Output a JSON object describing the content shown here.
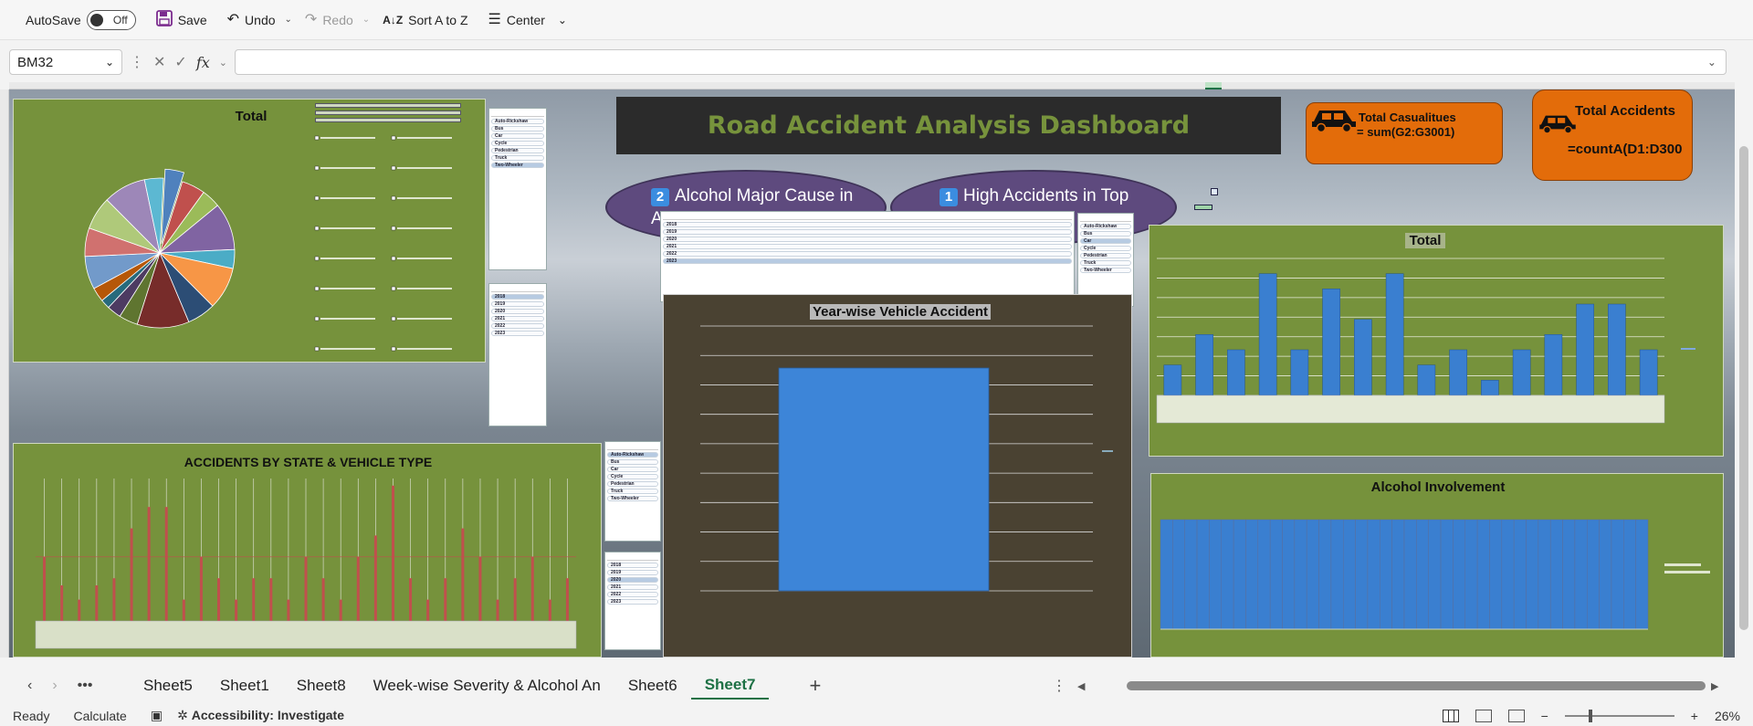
{
  "toolbar": {
    "autosave_label": "AutoSave",
    "autosave_state": "Off",
    "save_label": "Save",
    "undo_label": "Undo",
    "redo_label": "Redo",
    "sort_label": "Sort A to Z",
    "center_label": "Center"
  },
  "formula_bar": {
    "name_box": "BM32",
    "formula": ""
  },
  "dashboard": {
    "title": "Road Accident Analysis Dashboard",
    "insight1_num": "2",
    "insight1_text": "Alcohol Major Cause in Accidents",
    "insight2_num": "1",
    "insight2_text": "High Accidents in Top States",
    "kpi1_title": "Total Casualitues",
    "kpi1_formula": "= sum(G2:G3001)",
    "kpi2_title": "Total Accidents",
    "kpi2_formula": "=countA(D1:D300",
    "chart_pie_title": "Total",
    "chart_state_title": "ACCIDENTS BY STATE & VEHICLE TYPE",
    "chart_year_title": "Year-wise Vehicle Accident",
    "chart_total_title": "Total",
    "chart_alcohol_title": "Alcohol Involvement"
  },
  "chart_data": [
    {
      "type": "pie",
      "title": "Total",
      "values": [
        4,
        5,
        4,
        10,
        4,
        9,
        6,
        11,
        4,
        3,
        2,
        3,
        7,
        6,
        7,
        9,
        4
      ]
    },
    {
      "type": "bar",
      "title": "ACCIDENTS BY STATE & VEHICLE TYPE",
      "values": [
        9,
        5,
        3,
        5,
        6,
        13,
        16,
        16,
        3,
        9,
        6,
        3,
        6,
        6,
        3,
        9,
        6,
        3,
        9,
        12,
        19,
        6,
        3,
        6,
        13,
        9,
        3,
        6,
        9,
        3,
        6
      ]
    },
    {
      "type": "bar",
      "title": "Year-wise Vehicle Accident",
      "values": [
        1
      ]
    },
    {
      "type": "bar",
      "title": "Total",
      "values": [
        2,
        4,
        3,
        8,
        3,
        7,
        5,
        8,
        2,
        3,
        1,
        3,
        4,
        6,
        6,
        3
      ]
    },
    {
      "type": "bar",
      "title": "Alcohol Involvement",
      "values": [
        1,
        1,
        1,
        1,
        1,
        1,
        1,
        1,
        1,
        1,
        1,
        1,
        1,
        1,
        1,
        1,
        1,
        1,
        1,
        1,
        1,
        1,
        1,
        1,
        1,
        1,
        1,
        1,
        1,
        1,
        1,
        1,
        1,
        1,
        1,
        1,
        1,
        1,
        1,
        1
      ]
    }
  ],
  "slicers": {
    "vehicle_items": [
      "Auto-Rickshaw",
      "Bus",
      "Car",
      "Cycle",
      "Pedestrian",
      "Truck",
      "Two-Wheeler"
    ],
    "year_items": [
      "2018",
      "2019",
      "2020",
      "2021",
      "2022",
      "2023"
    ]
  },
  "sheet_tabs": [
    "Sheet5",
    "Sheet1",
    "Sheet8",
    "Week-wise Severity & Alcohol An",
    "Sheet6",
    "Sheet7"
  ],
  "active_tab": "Sheet7",
  "status": {
    "ready": "Ready",
    "calculate": "Calculate",
    "accessibility": "Accessibility: Investigate",
    "zoom": "26%"
  },
  "colors": {
    "panel_green": "#76923c",
    "kpi_orange": "#e36c0a",
    "insight_purple": "#5e4a7e",
    "bar_blue": "#3a7fd0",
    "bar_red": "#c0504d"
  }
}
